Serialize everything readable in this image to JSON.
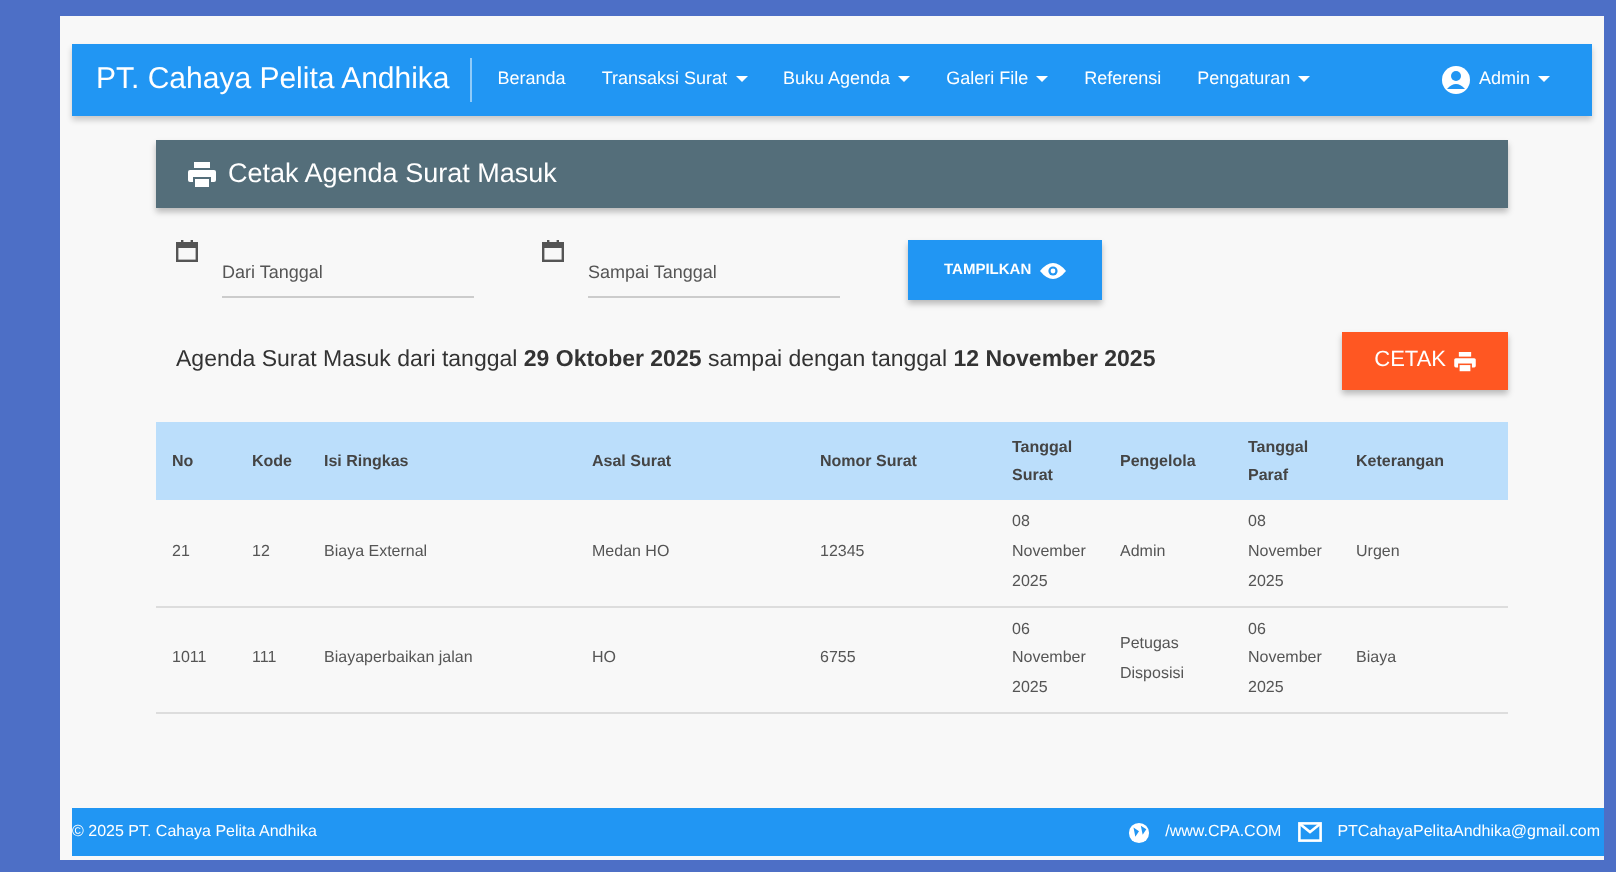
{
  "navbar": {
    "brand": "PT. Cahaya Pelita Andhika",
    "items": [
      {
        "label": "Beranda",
        "dropdown": false
      },
      {
        "label": "Transaksi Surat",
        "dropdown": true
      },
      {
        "label": "Buku Agenda",
        "dropdown": true
      },
      {
        "label": "Galeri File",
        "dropdown": true
      },
      {
        "label": "Referensi",
        "dropdown": false
      },
      {
        "label": "Pengaturan",
        "dropdown": true
      }
    ],
    "user": "Admin"
  },
  "panel_title": "Cetak Agenda Surat Masuk",
  "filters": [
    {
      "placeholder": "Dari Tanggal"
    },
    {
      "placeholder": "Sampai Tanggal"
    }
  ],
  "show_button": "TAMPILKAN",
  "summary": "Agenda Surat Masuk dari tanggal **29 Oktober 2025** sampai dengan tanggal **12 November 2025**",
  "print_button": "CETAK",
  "table": {
    "columns": [
      "No",
      "Kode",
      "Isi Ringkas",
      "Asal Surat",
      "Nomor Surat",
      "Tanggal Surat",
      "Pengelola",
      "Tanggal Paraf",
      "Keterangan"
    ],
    "rows": [
      [
        "21",
        "12",
        "Biaya External",
        "Medan HO",
        "12345",
        "08 November 2025",
        "Admin",
        "08 November 2025",
        "Urgen"
      ],
      [
        "1011",
        "111",
        "Biayaperbaikan jalan",
        "HO",
        "6755",
        "06 November 2025",
        "Petugas Disposisi",
        "06 November 2025",
        "Biaya"
      ]
    ]
  },
  "footer": {
    "copyright": "© 2025 PT. Cahaya Pelita Andhika",
    "website": "/www.CPA.COM",
    "email": "PTCahayaPelitaAndhika@gmail.com"
  }
}
